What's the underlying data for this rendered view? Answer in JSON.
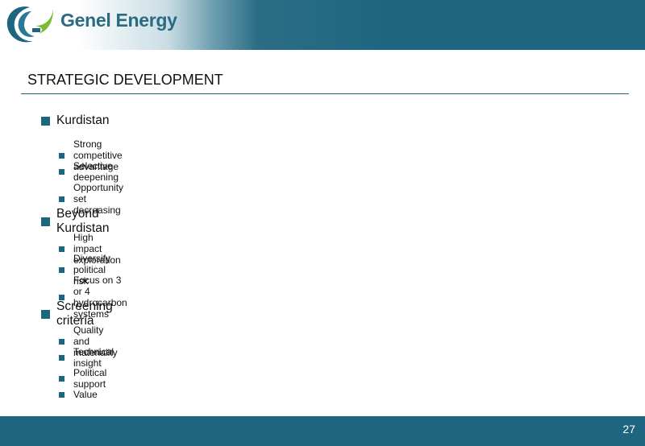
{
  "brand": {
    "name": "Genel Energy",
    "primary_color": "#1e6680",
    "accent_green": "#7dbb35"
  },
  "slide": {
    "title": "STRATEGIC DEVELOPMENT",
    "page_number": "27"
  },
  "sections": [
    {
      "label": "Kurdistan",
      "items": [
        "Strong competitive advantage",
        "Selective deepening",
        "Opportunity set decreasing"
      ]
    },
    {
      "label": "Beyond Kurdistan",
      "items": [
        "High impact exploration",
        "Diversify political risk",
        "Focus on 3 or 4 hydrocarbon systems"
      ]
    },
    {
      "label": "Screening criteria",
      "items": [
        "Quality and materiality",
        "Technical insight",
        "Political support",
        "Value"
      ]
    }
  ]
}
